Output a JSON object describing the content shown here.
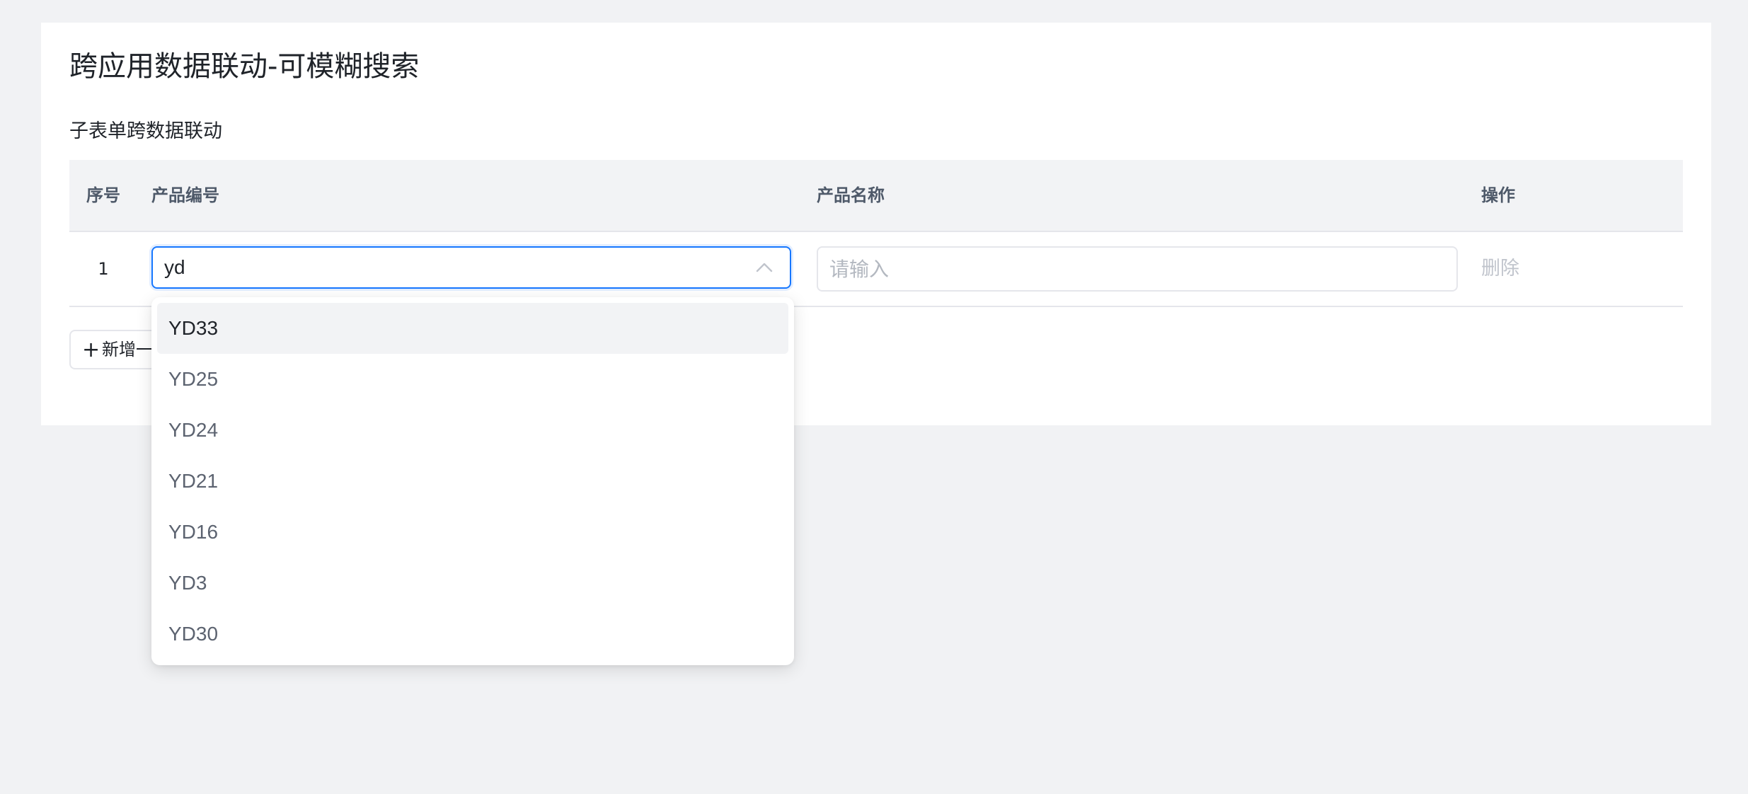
{
  "page": {
    "title": "跨应用数据联动-可模糊搜索",
    "section_title": "子表单跨数据联动"
  },
  "table": {
    "columns": [
      "序号",
      "产品编号",
      "产品名称",
      "操作"
    ],
    "rows": [
      {
        "index": "1",
        "product_code": "yd",
        "product_name_placeholder": "请输入",
        "action": "删除"
      }
    ],
    "add_button_label": "新增一"
  },
  "dropdown": {
    "options": [
      "YD33",
      "YD25",
      "YD24",
      "YD21",
      "YD16",
      "YD3",
      "YD30"
    ],
    "highlighted": "YD33"
  },
  "icons": {
    "select": "chevron-up-icon",
    "add": "plus-icon"
  },
  "colors": {
    "focus": "#1677ff",
    "header_bg": "#f2f3f5",
    "page_bg": "#f1f2f4",
    "disabled_text": "#c0c4cc"
  }
}
